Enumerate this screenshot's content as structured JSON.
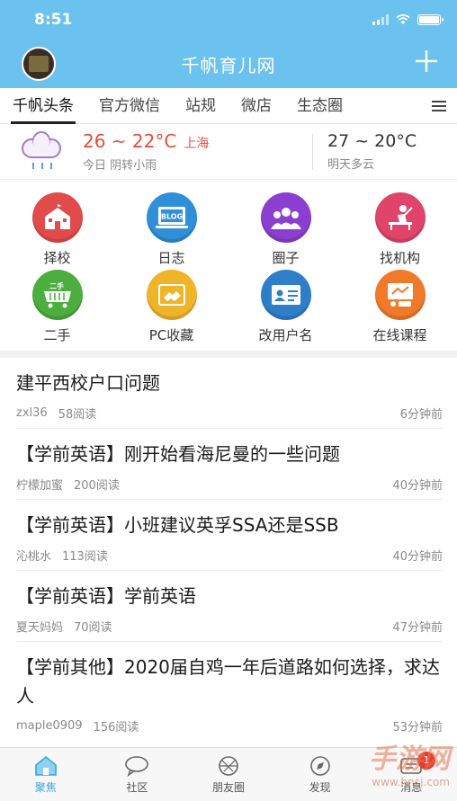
{
  "status": {
    "time": "8:51"
  },
  "header": {
    "title": "千帆育儿网"
  },
  "tabs": [
    {
      "label": "千帆头条",
      "active": true
    },
    {
      "label": "官方微信",
      "active": false
    },
    {
      "label": "站规",
      "active": false
    },
    {
      "label": "微店",
      "active": false
    },
    {
      "label": "生态圈",
      "active": false
    }
  ],
  "weather": {
    "today_temp": "26 ~ 22°C",
    "city": "上海",
    "today_desc": "今日 阴转小雨",
    "tomorrow_temp": "27 ~ 20°C",
    "tomorrow_desc": "明天多云"
  },
  "grid": [
    {
      "label": "择校",
      "icon": "school-icon",
      "color": "#e24b4b",
      "glyph": ""
    },
    {
      "label": "日志",
      "icon": "blog-icon",
      "color": "#2f8fd8",
      "glyph": "BLOG"
    },
    {
      "label": "圈子",
      "icon": "group-icon",
      "color": "#8a3fd0",
      "glyph": ""
    },
    {
      "label": "找机构",
      "icon": "teacher-icon",
      "color": "#e0446a",
      "glyph": ""
    },
    {
      "label": "二手",
      "icon": "cart-icon",
      "color": "#4cae3f",
      "glyph": "二手"
    },
    {
      "label": "PC收藏",
      "icon": "handshake-icon",
      "color": "#f0b429",
      "glyph": ""
    },
    {
      "label": "改用户名",
      "icon": "id-card-icon",
      "color": "#2f7fc8",
      "glyph": ""
    },
    {
      "label": "在线课程",
      "icon": "presentation-icon",
      "color": "#f07a2a",
      "glyph": ""
    }
  ],
  "posts": [
    {
      "title": "建平西校户口问题",
      "author": "zxl36",
      "reads": "58阅读",
      "ago": "6分钟前"
    },
    {
      "title": "【学前英语】刚开始看海尼曼的一些问题",
      "author": "柠檬加蜜",
      "reads": "200阅读",
      "ago": "40分钟前"
    },
    {
      "title": "【学前英语】小班建议英孚SSA还是SSB",
      "author": "沁桃水",
      "reads": "113阅读",
      "ago": "40分钟前"
    },
    {
      "title": "【学前英语】学前英语",
      "author": "夏天妈妈",
      "reads": "70阅读",
      "ago": "47分钟前"
    },
    {
      "title": "【学前其他】2020届自鸡一年后道路如何选择，求达人",
      "author": "maple0909",
      "reads": "156阅读",
      "ago": "53分钟前"
    }
  ],
  "bottom_nav": [
    {
      "label": "聚焦",
      "icon": "home-icon",
      "active": true
    },
    {
      "label": "社区",
      "icon": "chat-bubble-icon",
      "active": false
    },
    {
      "label": "朋友圈",
      "icon": "camera-aperture-icon",
      "active": false
    },
    {
      "label": "发现",
      "icon": "compass-icon",
      "active": false
    },
    {
      "label": "消息",
      "icon": "message-icon",
      "active": false,
      "badge": "1"
    }
  ],
  "watermark": {
    "main": "手游网",
    "sub": "www.hncj.com"
  },
  "colors": {
    "header_bg": "#6cc2ee",
    "accent": "#3ba6dc",
    "temp_red": "#e74c3c"
  }
}
